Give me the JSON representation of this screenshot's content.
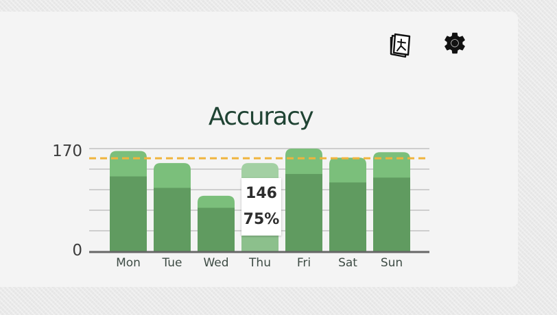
{
  "toolbar": {
    "icons": [
      "kanji-book-icon",
      "gear-icon"
    ]
  },
  "colors": {
    "bar_total": "#7bbf7b",
    "bar_correct": "#609b60",
    "bar_hover_total": "#a3d0a3",
    "bar_hover_correct": "#8cc08c",
    "target_line": "#f0b43c",
    "gridline": "#c2c2c2",
    "axis": "#666666",
    "title": "#1f4333"
  },
  "chart_data": {
    "type": "bar",
    "title": "Accuracy",
    "categories": [
      "Mon",
      "Tue",
      "Wed",
      "Thu",
      "Fri",
      "Sat",
      "Sun"
    ],
    "series": [
      {
        "role": "total",
        "values": [
          166,
          146,
          92,
          146,
          170,
          155,
          164
        ]
      },
      {
        "role": "correct",
        "values": [
          124,
          105,
          72,
          110,
          128,
          114,
          122
        ]
      }
    ],
    "target": 154,
    "ylim": [
      0,
      170
    ],
    "yticks": [
      0,
      170
    ],
    "grid": true,
    "highlight": {
      "category": "Thu",
      "value_label": "146",
      "percent_label": "75%"
    }
  }
}
